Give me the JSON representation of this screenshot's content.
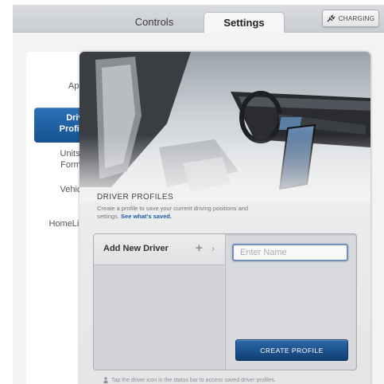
{
  "tabs": [
    {
      "label": "Controls",
      "active": false
    },
    {
      "label": "Settings",
      "active": true
    }
  ],
  "charging_button": {
    "label": "CHARGING",
    "icon": "plug-icon"
  },
  "sidebar": {
    "items": [
      {
        "label": "Apps",
        "active": false
      },
      {
        "label": "Driver Profiles",
        "active": true
      },
      {
        "label": "Units & Format",
        "active": false
      },
      {
        "label": "Vehicle",
        "active": false
      },
      {
        "label": "HomeLink",
        "active": false
      }
    ]
  },
  "driver_profiles": {
    "title": "DRIVER PROFILES",
    "description": "Create a profile to save your current driving positions and settings.",
    "description_link": "See what's saved.",
    "add_driver_label": "Add New Driver",
    "name_placeholder": "Enter Name",
    "create_button": "CREATE PROFILE",
    "footer_hint": "Tap the driver icon in the status bar to access saved driver profiles."
  },
  "colors": {
    "accent_blue": "#1e5fa6",
    "button_blue": "#123f73"
  }
}
